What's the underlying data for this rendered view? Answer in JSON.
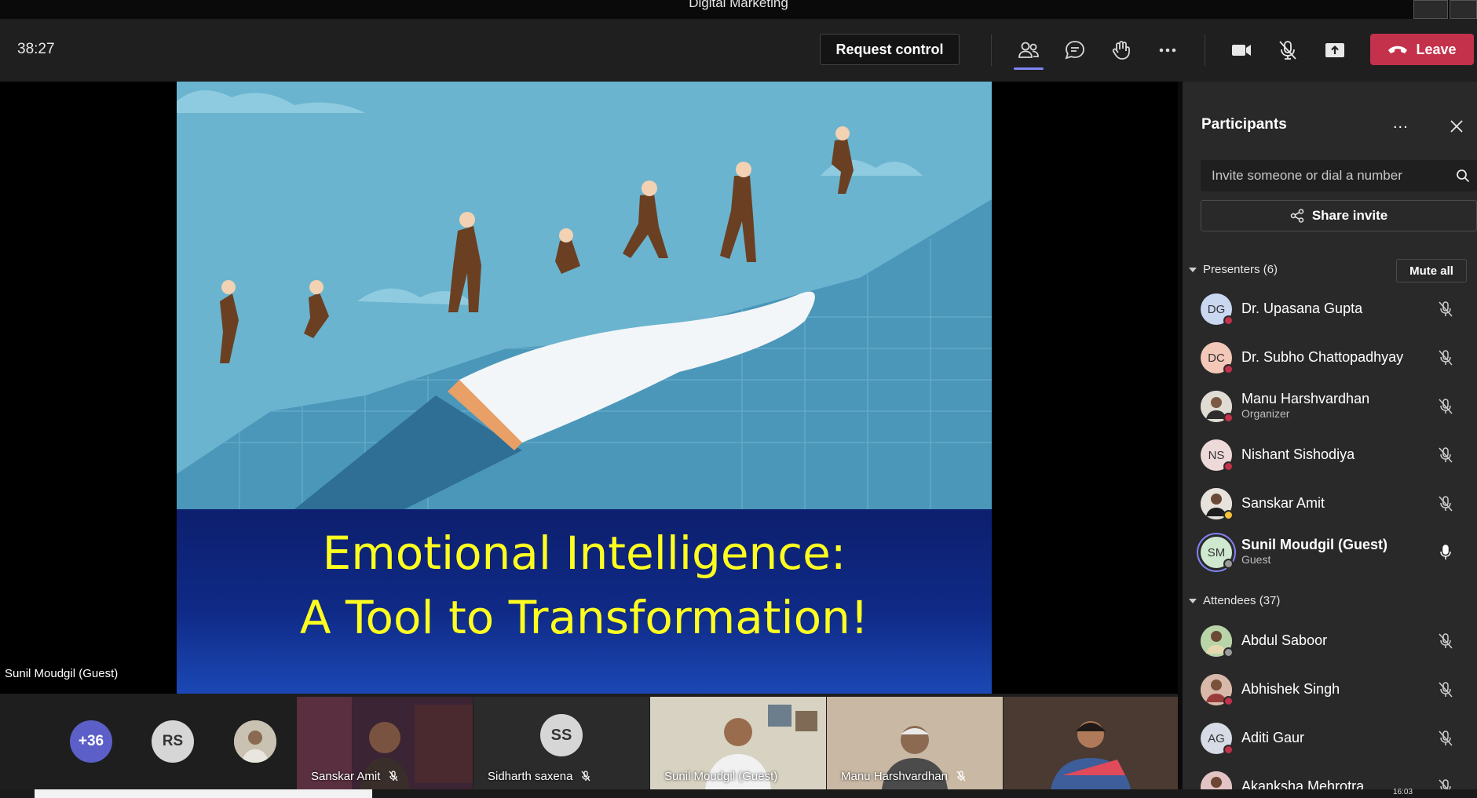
{
  "window": {
    "title": "Digital Marketing"
  },
  "toolbar": {
    "timer": "38:27",
    "request_control_label": "Request control",
    "leave_label": "Leave",
    "icons": [
      "people-icon",
      "chat-icon",
      "raise-hand-icon",
      "more-icon",
      "camera-icon",
      "mic-off-icon",
      "share-tray-icon",
      "phone-hangup-icon"
    ]
  },
  "stage": {
    "slide_title_line1": "Emotional Intelligence:",
    "slide_title_line2": "A Tool to Transformation!",
    "presenter_label": "Sunil Moudgil (Guest)"
  },
  "gallery": {
    "overflow_count": "+36",
    "bubble_initials": "RS",
    "tiles": [
      {
        "name": "Sanskar Amit",
        "muted": true
      },
      {
        "name": "Sidharth saxena",
        "initials": "SS",
        "muted": true
      },
      {
        "name": "Sunil Moudgil (Guest)",
        "muted": false
      },
      {
        "name": "Manu Harshvardhan",
        "muted": true
      },
      {
        "name": "",
        "muted": false
      }
    ]
  },
  "panel": {
    "title": "Participants",
    "more": "...",
    "invite_placeholder": "Invite someone or dial a number",
    "share_invite_label": "Share invite",
    "presenters_header": "Presenters (6)",
    "mute_all_label": "Mute all",
    "attendees_header": "Attendees (37)",
    "presenters": [
      {
        "initials": "DG",
        "name": "Dr. Upasana Gupta",
        "sub": "",
        "mic": "muted"
      },
      {
        "initials": "DC",
        "name": "Dr. Subho Chattopadhyay",
        "sub": "",
        "mic": "muted"
      },
      {
        "initials": "",
        "name": "Manu Harshvardhan",
        "sub": "Organizer",
        "mic": "muted"
      },
      {
        "initials": "NS",
        "name": "Nishant Sishodiya",
        "sub": "",
        "mic": "muted"
      },
      {
        "initials": "",
        "name": "Sanskar Amit",
        "sub": "",
        "mic": "muted"
      },
      {
        "initials": "SM",
        "name": "Sunil Moudgil (Guest)",
        "sub": "Guest",
        "mic": "on"
      }
    ],
    "attendees": [
      {
        "initials": "",
        "name": "Abdul Saboor",
        "mic": "muted"
      },
      {
        "initials": "",
        "name": "Abhishek Singh",
        "mic": "muted"
      },
      {
        "initials": "AG",
        "name": "Aditi Gaur",
        "mic": "muted"
      },
      {
        "initials": "",
        "name": "Akanksha Mehrotra",
        "mic": "muted"
      }
    ]
  },
  "taskbar": {
    "clock": "16:03"
  },
  "colors": {
    "accent": "#7f85f5",
    "leave": "#c4314b",
    "away": "#c4314b",
    "available": "#92c353",
    "slide_title": "#ffff1f"
  }
}
